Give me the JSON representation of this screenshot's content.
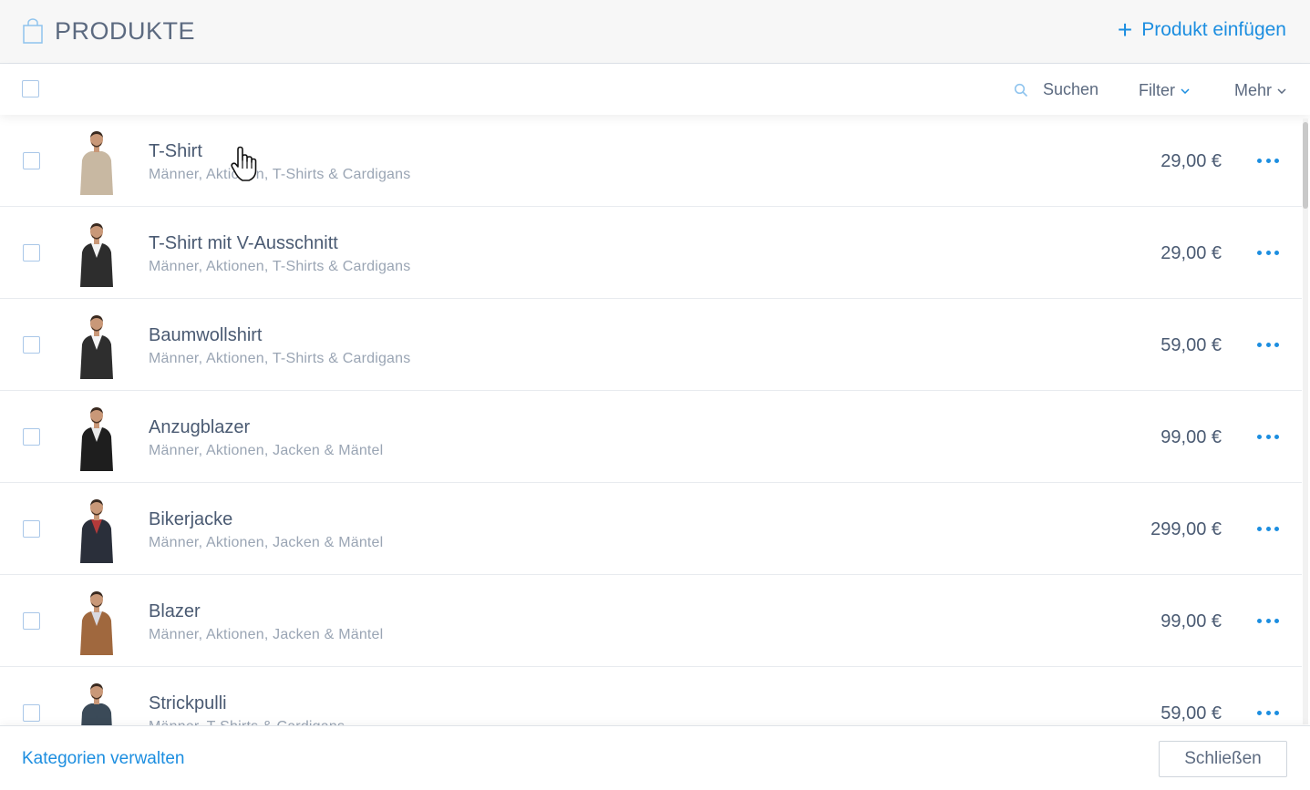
{
  "header": {
    "title": "PRODUKTE",
    "add_label": "Produkt einfügen",
    "add_icon": "plus-icon",
    "bag_icon": "shopping-bag-icon"
  },
  "toolbar": {
    "search_label": "Suchen",
    "filter_label": "Filter",
    "more_label": "Mehr"
  },
  "products": [
    {
      "name": "T-Shirt",
      "categories": "Männer, Aktionen, T-Shirts & Cardigans",
      "price": "29,00 €",
      "shirt_color": "#c8b8a2",
      "jacket_color": "#c8b8a2"
    },
    {
      "name": "T-Shirt mit V-Ausschnitt",
      "categories": "Männer, Aktionen, T-Shirts & Cardigans",
      "price": "29,00 €",
      "shirt_color": "#f2f2f2",
      "jacket_color": "#2d2d2d"
    },
    {
      "name": "Baumwollshirt",
      "categories": "Männer, Aktionen, T-Shirts & Cardigans",
      "price": "59,00 €",
      "shirt_color": "#f4f4f4",
      "jacket_color": "#2e2e2e"
    },
    {
      "name": "Anzugblazer",
      "categories": "Männer, Aktionen, Jacken & Mäntel",
      "price": "99,00 €",
      "shirt_color": "#e8e8e8",
      "jacket_color": "#1e1e1e"
    },
    {
      "name": "Bikerjacke",
      "categories": "Männer, Aktionen, Jacken & Mäntel",
      "price": "299,00 €",
      "shirt_color": "#b23a3a",
      "jacket_color": "#2a2f3a"
    },
    {
      "name": "Blazer",
      "categories": "Männer, Aktionen, Jacken & Mäntel",
      "price": "99,00 €",
      "shirt_color": "#d8d8e0",
      "jacket_color": "#a0683e"
    },
    {
      "name": "Strickpulli",
      "categories": "Männer, T-Shirts & Cardigans",
      "price": "59,00 €",
      "shirt_color": "#3b4a58",
      "jacket_color": "#3b4a58"
    }
  ],
  "footer": {
    "manage_label": "Kategorien verwalten",
    "close_label": "Schließen"
  },
  "colors": {
    "accent": "#1c8ee0",
    "text": "#4a5a72",
    "muted": "#9aa5b4"
  }
}
